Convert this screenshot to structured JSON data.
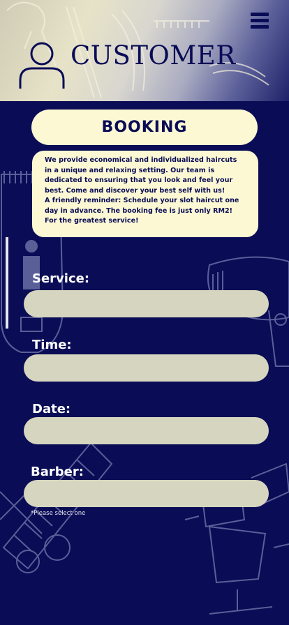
{
  "header": {
    "title": "CUSTOMER",
    "menu_icon": "hamburger-menu-icon",
    "avatar_icon": "user-avatar-icon"
  },
  "booking": {
    "heading": "BOOKING",
    "description_lines": [
      "We provide economical and individualized haircuts",
      "in a unique and relaxing setting. Our team is",
      "dedicated to ensuring that you look and feel your",
      "best. Come and discover your best self with us!",
      "A friendly reminder: Schedule your slot haircut one",
      "day in advance. The booking fee is just only RM2!",
      "For the greatest service!"
    ]
  },
  "form": {
    "service": {
      "label": "Service:",
      "value": ""
    },
    "time": {
      "label": "Time:",
      "value": ""
    },
    "date": {
      "label": "Date:",
      "value": ""
    },
    "barber": {
      "label": "Barber:",
      "value": ""
    },
    "hint": "*Please select one"
  },
  "colors": {
    "background": "#0a0c56",
    "card": "#fbf8d3",
    "input": "#d6d5bf",
    "text_dark": "#0a0c56",
    "label": "#ffffff"
  }
}
